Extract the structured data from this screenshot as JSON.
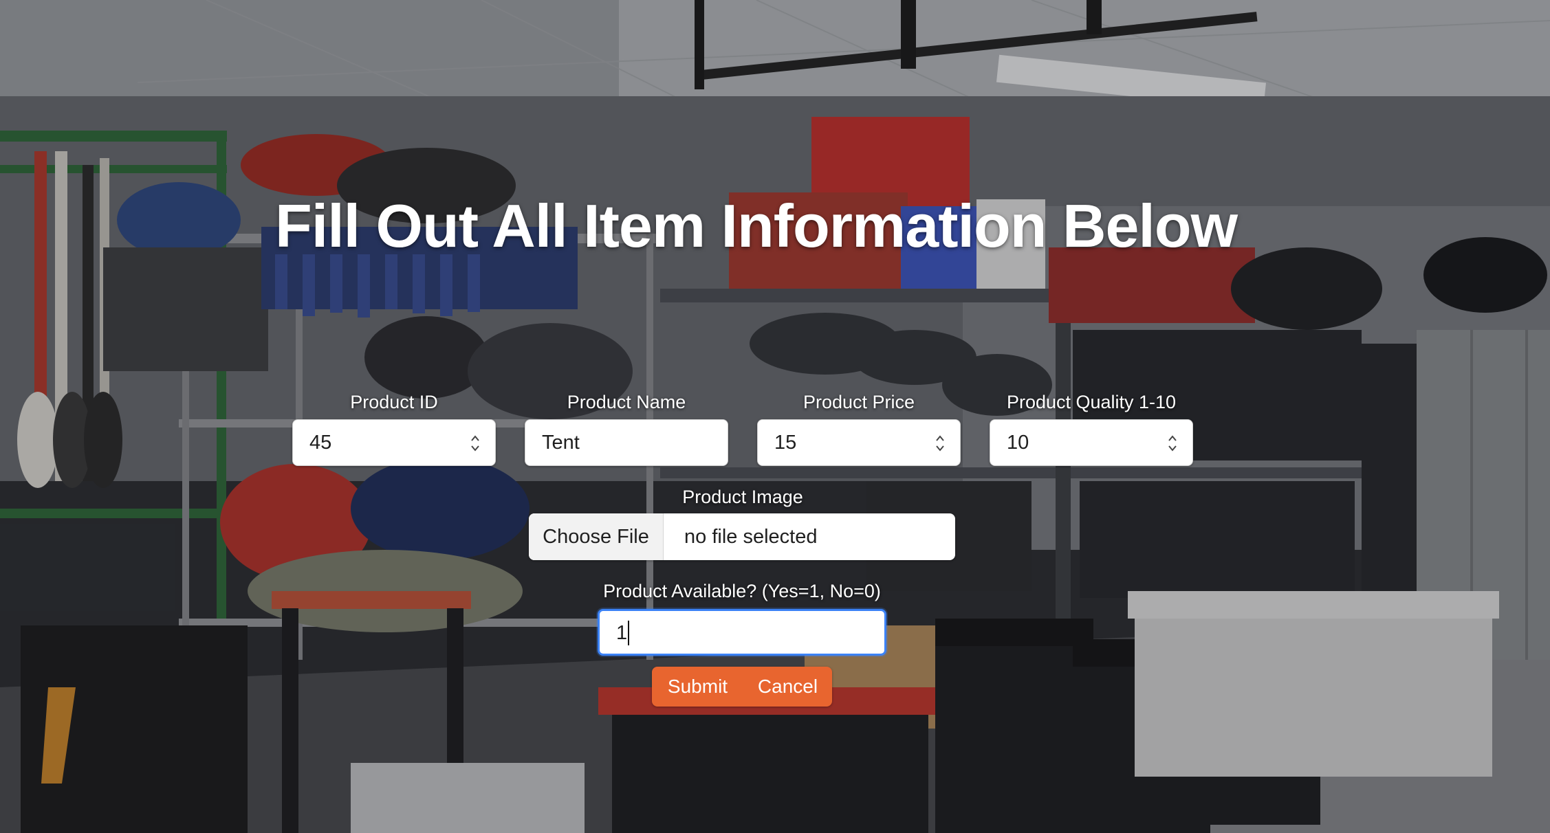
{
  "page": {
    "title": "Fill Out All Item Information Below"
  },
  "form": {
    "fields": [
      {
        "label": "Product ID",
        "value": "45",
        "type": "number"
      },
      {
        "label": "Product Name",
        "value": "Tent",
        "type": "text"
      },
      {
        "label": "Product Price",
        "value": "15",
        "type": "number"
      },
      {
        "label": "Product Quality 1-10",
        "value": "10",
        "type": "number"
      }
    ],
    "image": {
      "label": "Product Image",
      "button_label": "Choose File",
      "status": "no file selected"
    },
    "available": {
      "label": "Product Available? (Yes=1, No=0)",
      "value": "1"
    },
    "buttons": {
      "submit": "Submit",
      "cancel": "Cancel"
    }
  },
  "colors": {
    "button_accent": "#e8652f",
    "focus_ring": "#3b82f6",
    "title_text": "#ffffff"
  },
  "icons": {
    "spinner": "up-down-spinner-icon"
  }
}
